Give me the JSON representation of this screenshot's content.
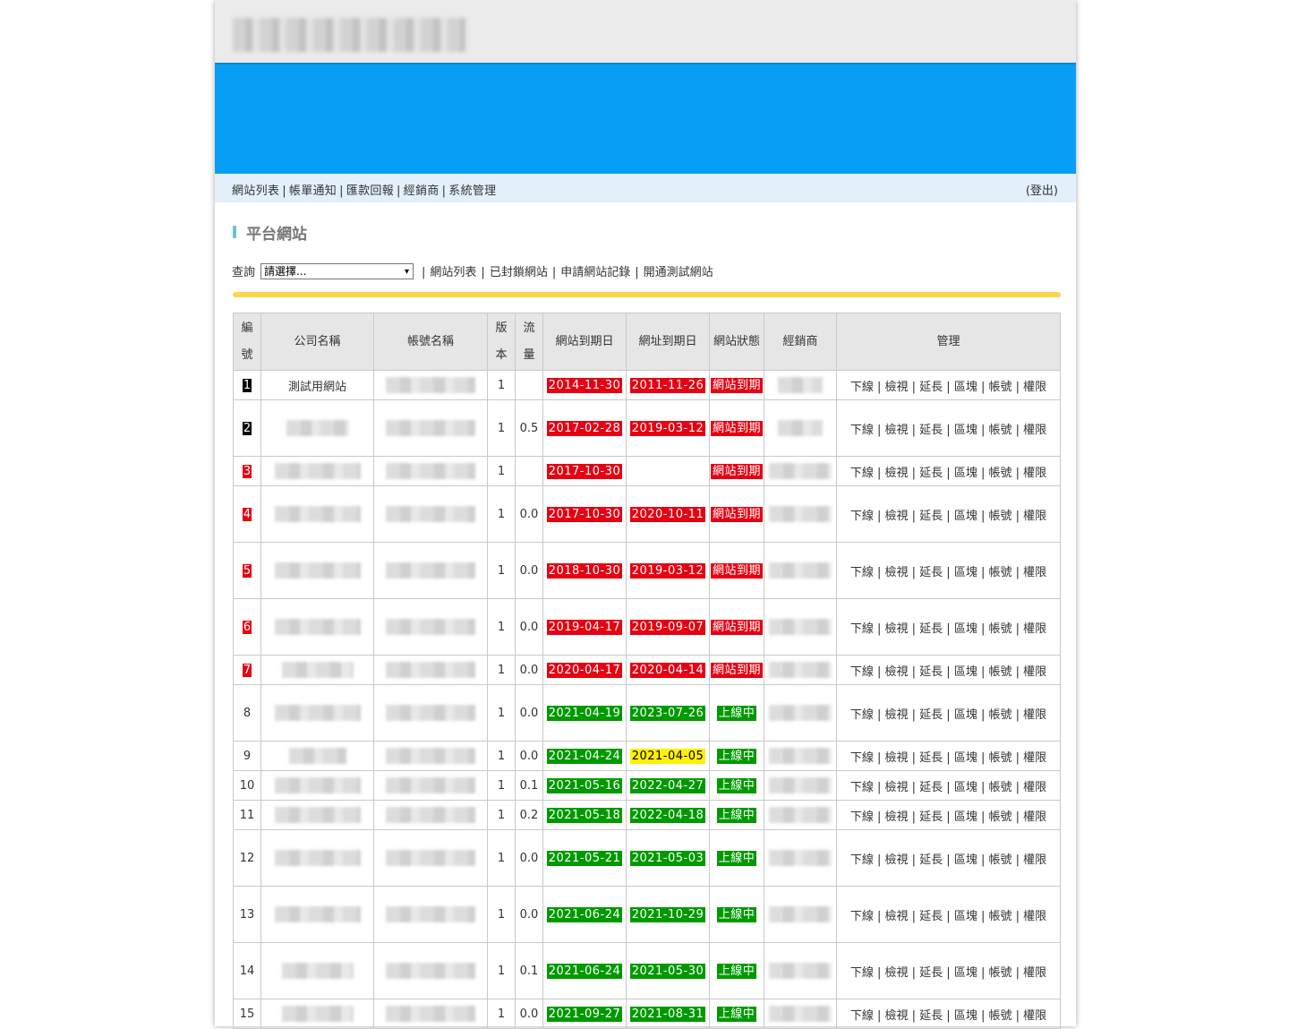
{
  "nav": {
    "items": [
      "網站列表",
      "帳單通知",
      "匯款回報",
      "經銷商",
      "系統管理"
    ],
    "logout": "(登出)"
  },
  "section_title": "平台網站",
  "query": {
    "label": "查詢",
    "select_value": "請選擇...",
    "links": [
      "網站列表",
      "已封鎖網站",
      "申請網站記錄",
      "開通測試網站"
    ]
  },
  "table": {
    "headers": {
      "no": [
        "編",
        "號"
      ],
      "company": "公司名稱",
      "account": "帳號名稱",
      "version": [
        "版",
        "本"
      ],
      "traffic": [
        "流",
        "量"
      ],
      "site_expire": "網站到期日",
      "domain_expire": "網址到期日",
      "status": "網站狀態",
      "dealer": "經銷商",
      "manage": "管理"
    },
    "actions": [
      "下線",
      "檢視",
      "延長",
      "區塊",
      "帳號",
      "權限"
    ],
    "rows": [
      {
        "no": "1",
        "no_style": "black",
        "company": "測試用網站",
        "version": "1",
        "traffic": "",
        "site_expire": "2014-11-30",
        "site_color": "red",
        "domain_expire": "2011-11-26",
        "domain_color": "red",
        "status": "網站到期",
        "status_color": "red",
        "h": 33
      },
      {
        "no": "2",
        "no_style": "black",
        "company": "",
        "version": "1",
        "traffic": "0.5",
        "site_expire": "2017-02-28",
        "site_color": "red",
        "domain_expire": "2019-03-12",
        "domain_color": "red",
        "status": "網站到期",
        "status_color": "red",
        "h": 63
      },
      {
        "no": "3",
        "no_style": "bad",
        "company": "",
        "version": "1",
        "traffic": "",
        "site_expire": "2017-10-30",
        "site_color": "red",
        "domain_expire": "",
        "domain_color": "",
        "status": "網站到期",
        "status_color": "red",
        "h": 33
      },
      {
        "no": "4",
        "no_style": "bad",
        "company": "",
        "version": "1",
        "traffic": "0.0",
        "site_expire": "2017-10-30",
        "site_color": "red",
        "domain_expire": "2020-10-11",
        "domain_color": "red",
        "status": "網站到期",
        "status_color": "red",
        "h": 63
      },
      {
        "no": "5",
        "no_style": "bad",
        "company": "",
        "version": "1",
        "traffic": "0.0",
        "site_expire": "2018-10-30",
        "site_color": "red",
        "domain_expire": "2019-03-12",
        "domain_color": "red",
        "status": "網站到期",
        "status_color": "red",
        "h": 63
      },
      {
        "no": "6",
        "no_style": "bad",
        "company": "",
        "version": "1",
        "traffic": "0.0",
        "site_expire": "2019-04-17",
        "site_color": "red",
        "domain_expire": "2019-09-07",
        "domain_color": "red",
        "status": "網站到期",
        "status_color": "red",
        "h": 63
      },
      {
        "no": "7",
        "no_style": "bad",
        "company": "",
        "version": "1",
        "traffic": "0.0",
        "site_expire": "2020-04-17",
        "site_color": "red",
        "domain_expire": "2020-04-14",
        "domain_color": "red",
        "status": "網站到期",
        "status_color": "red",
        "h": 33
      },
      {
        "no": "8",
        "no_style": "plain",
        "company": "",
        "version": "1",
        "traffic": "0.0",
        "site_expire": "2021-04-19",
        "site_color": "green",
        "domain_expire": "2023-07-26",
        "domain_color": "green",
        "status": "上線中",
        "status_color": "green",
        "h": 63
      },
      {
        "no": "9",
        "no_style": "plain",
        "company": "",
        "version": "1",
        "traffic": "0.0",
        "site_expire": "2021-04-24",
        "site_color": "green",
        "domain_expire": "2021-04-05",
        "domain_color": "yellow",
        "status": "上線中",
        "status_color": "green",
        "h": 33
      },
      {
        "no": "10",
        "no_style": "plain",
        "company": "",
        "version": "1",
        "traffic": "0.1",
        "site_expire": "2021-05-16",
        "site_color": "green",
        "domain_expire": "2022-04-27",
        "domain_color": "green",
        "status": "上線中",
        "status_color": "green",
        "h": 33
      },
      {
        "no": "11",
        "no_style": "plain",
        "company": "",
        "version": "1",
        "traffic": "0.2",
        "site_expire": "2021-05-18",
        "site_color": "green",
        "domain_expire": "2022-04-18",
        "domain_color": "green",
        "status": "上線中",
        "status_color": "green",
        "h": 33
      },
      {
        "no": "12",
        "no_style": "plain",
        "company": "",
        "version": "1",
        "traffic": "0.0",
        "site_expire": "2021-05-21",
        "site_color": "green",
        "domain_expire": "2021-05-03",
        "domain_color": "green",
        "status": "上線中",
        "status_color": "green",
        "h": 63
      },
      {
        "no": "13",
        "no_style": "plain",
        "company": "",
        "version": "1",
        "traffic": "0.0",
        "site_expire": "2021-06-24",
        "site_color": "green",
        "domain_expire": "2021-10-29",
        "domain_color": "green",
        "status": "上線中",
        "status_color": "green",
        "h": 63
      },
      {
        "no": "14",
        "no_style": "plain",
        "company": "",
        "version": "1",
        "traffic": "0.1",
        "site_expire": "2021-06-24",
        "site_color": "green",
        "domain_expire": "2021-05-30",
        "domain_color": "green",
        "status": "上線中",
        "status_color": "green",
        "h": 63
      },
      {
        "no": "15",
        "no_style": "plain",
        "company": "",
        "version": "1",
        "traffic": "0.0",
        "site_expire": "2021-09-27",
        "site_color": "green",
        "domain_expire": "2021-08-31",
        "domain_color": "green",
        "status": "上線中",
        "status_color": "green",
        "h": 33
      }
    ]
  },
  "colors": {
    "banner": "#079ff5",
    "expired": "#e60012",
    "online": "#009a00",
    "warning": "#fff000",
    "divider": "#fbd54d"
  }
}
